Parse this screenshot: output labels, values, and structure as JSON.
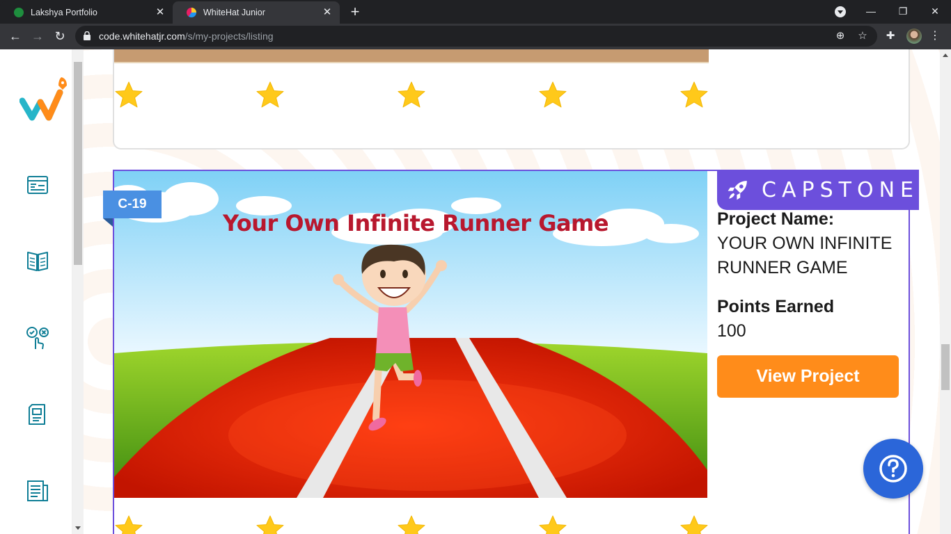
{
  "browser": {
    "tabs": [
      {
        "title": "Lakshya Portfolio",
        "active": false,
        "favicon_color": "#1e8e3e"
      },
      {
        "title": "WhiteHat Junior",
        "active": true,
        "favicon_color": "#2196f3"
      }
    ],
    "url_host": "code.whitehatjr.com",
    "url_path": "/s/my-projects/listing"
  },
  "sidebar": {
    "items": [
      {
        "name": "classes",
        "icon": "browser-window-icon"
      },
      {
        "name": "curriculum",
        "icon": "open-book-icon"
      },
      {
        "name": "quiz",
        "icon": "quiz-check-cross-icon"
      },
      {
        "name": "notes",
        "icon": "document-icon"
      },
      {
        "name": "projects",
        "icon": "file-list-icon"
      }
    ]
  },
  "project": {
    "code": "C-19",
    "thumbnail_title": "Your Own Infinite Runner Game",
    "tag": "CAPSTONE",
    "name_label": "Project Name:",
    "name_value": "YOUR OWN INFINITE RUNNER GAME",
    "points_label": "Points Earned",
    "points_value": "100",
    "view_button": "View Project",
    "star_count": 5
  },
  "colors": {
    "accent_purple": "#6c4fdc",
    "button_orange": "#ff8c1a",
    "code_badge_blue": "#4a90e2",
    "help_blue": "#2b66d9",
    "star_yellow": "#ffc91a",
    "title_red": "#b8182e"
  }
}
